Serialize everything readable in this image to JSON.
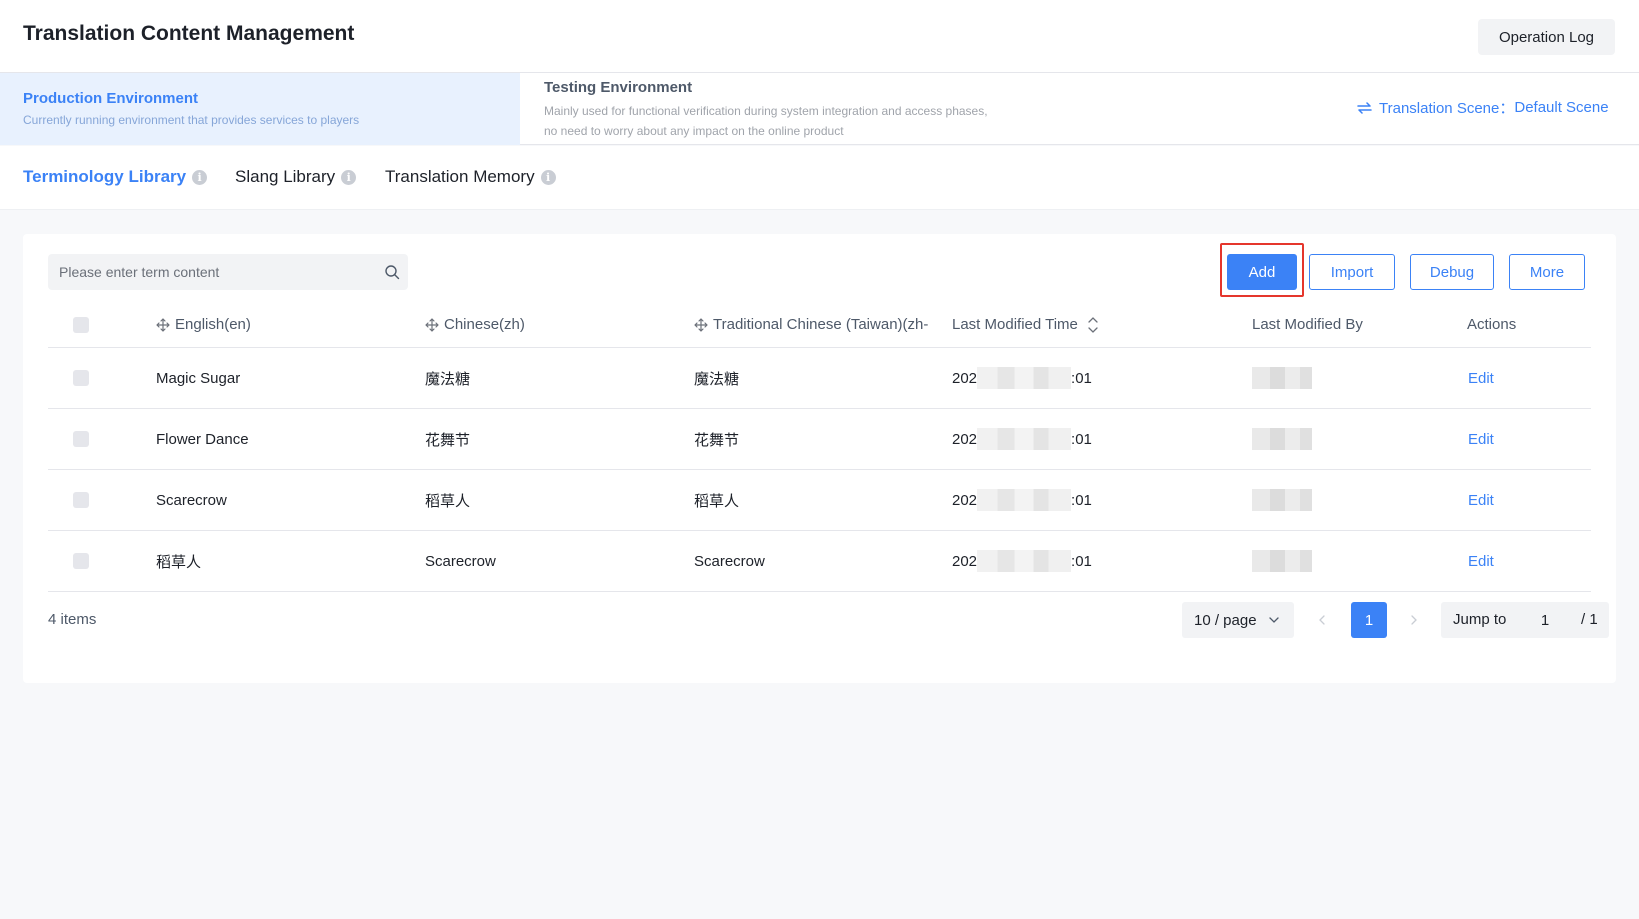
{
  "header": {
    "title": "Translation Content Management",
    "operation_log_label": "Operation Log"
  },
  "environments": {
    "production": {
      "name": "Production Environment",
      "description": "Currently running environment that provides services to players"
    },
    "testing": {
      "name": "Testing Environment",
      "description": "Mainly used for functional verification during system integration and access phases, no need to worry about any impact on the online product"
    },
    "scene_label": "Translation Scene：",
    "scene_value": "Default Scene"
  },
  "tabs": [
    {
      "label": "Terminology Library",
      "active": true
    },
    {
      "label": "Slang Library",
      "active": false
    },
    {
      "label": "Translation Memory",
      "active": false
    }
  ],
  "toolbar": {
    "search_placeholder": "Please enter term content",
    "add_label": "Add",
    "import_label": "Import",
    "debug_label": "Debug",
    "more_label": "More"
  },
  "table": {
    "columns": [
      "English(en)",
      "Chinese(zh)",
      "Traditional Chinese (Taiwan)(zh-",
      "Last Modified Time",
      "Last Modified By",
      "Actions"
    ],
    "rows": [
      {
        "en": "Magic Sugar",
        "zh": "魔法糖",
        "zh_tw": "魔法糖",
        "time_prefix": "202",
        "time_suffix": ":01",
        "action": "Edit"
      },
      {
        "en": "Flower Dance",
        "zh": "花舞节",
        "zh_tw": "花舞节",
        "time_prefix": "202",
        "time_suffix": ":01",
        "action": "Edit"
      },
      {
        "en": "Scarecrow",
        "zh": "稻草人",
        "zh_tw": "稻草人",
        "time_prefix": "202",
        "time_suffix": ":01",
        "action": "Edit"
      },
      {
        "en": "稻草人",
        "zh": "Scarecrow",
        "zh_tw": "Scarecrow",
        "time_prefix": "202",
        "time_suffix": ":01",
        "action": "Edit"
      }
    ]
  },
  "pagination": {
    "total": "4 items",
    "page_size": "10 / page",
    "current_page": "1",
    "jump_label": "Jump to",
    "jump_value": "1",
    "total_pages": "/ 1"
  },
  "colors": {
    "primary": "#3b82f6",
    "highlight": "#e5362c"
  }
}
